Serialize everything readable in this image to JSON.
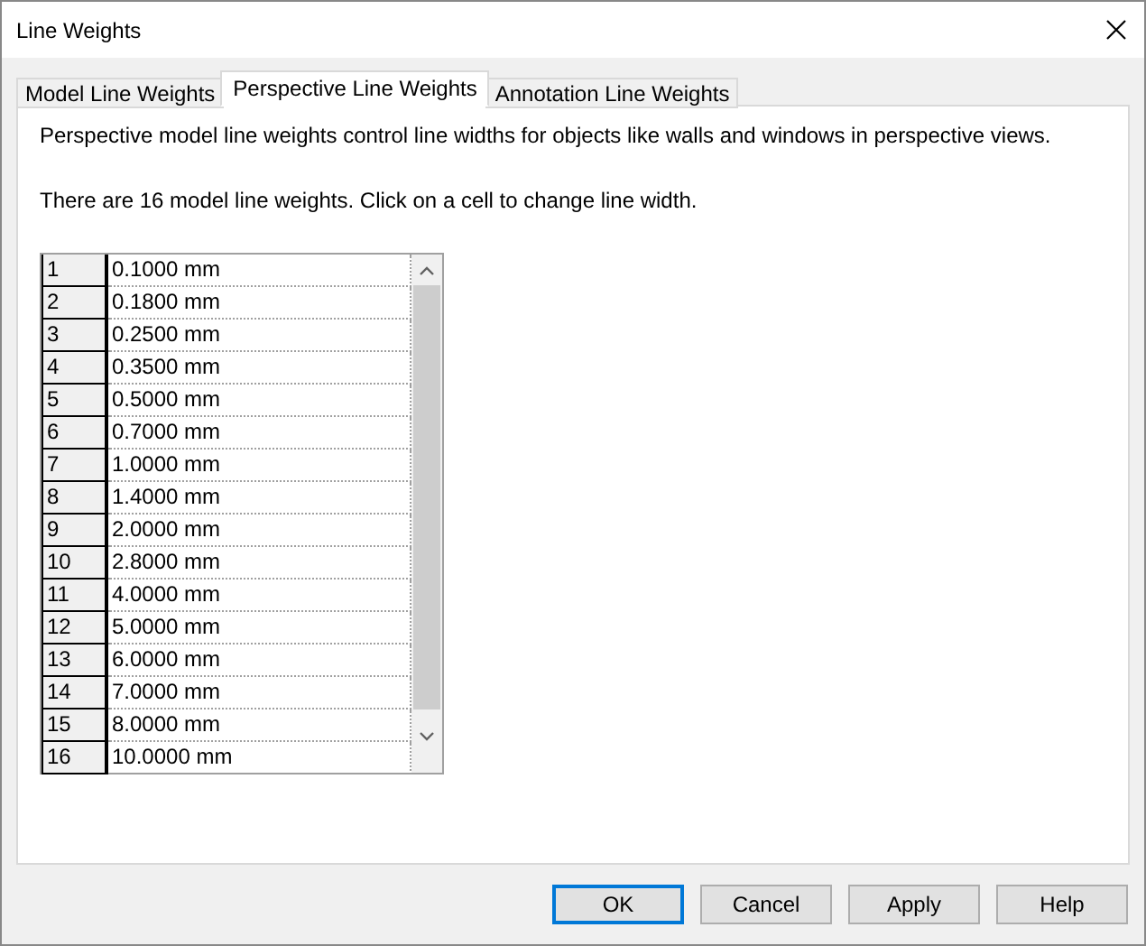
{
  "window": {
    "title": "Line Weights"
  },
  "tabs": [
    {
      "label": "Model Line Weights",
      "selected": false
    },
    {
      "label": "Perspective Line Weights",
      "selected": true
    },
    {
      "label": "Annotation Line Weights",
      "selected": false
    }
  ],
  "description": "Perspective model line weights control line widths for objects like walls and windows in perspective views.",
  "instruction": "There are 16 model line weights. Click on a cell to change line width.",
  "table": {
    "rows": [
      [
        "1",
        "0.1000 mm"
      ],
      [
        "2",
        "0.1800 mm"
      ],
      [
        "3",
        "0.2500 mm"
      ],
      [
        "4",
        "0.3500 mm"
      ],
      [
        "5",
        "0.5000 mm"
      ],
      [
        "6",
        "0.7000 mm"
      ],
      [
        "7",
        "1.0000 mm"
      ],
      [
        "8",
        "1.4000 mm"
      ],
      [
        "9",
        "2.0000 mm"
      ],
      [
        "10",
        "2.8000 mm"
      ],
      [
        "11",
        "4.0000 mm"
      ],
      [
        "12",
        "5.0000 mm"
      ],
      [
        "13",
        "6.0000 mm"
      ],
      [
        "14",
        "7.0000 mm"
      ],
      [
        "15",
        "8.0000 mm"
      ],
      [
        "16",
        "10.0000 mm"
      ]
    ]
  },
  "buttons": [
    {
      "label": "OK",
      "default": true
    },
    {
      "label": "Cancel",
      "default": false
    },
    {
      "label": "Apply",
      "default": false
    },
    {
      "label": "Help",
      "default": false
    }
  ]
}
